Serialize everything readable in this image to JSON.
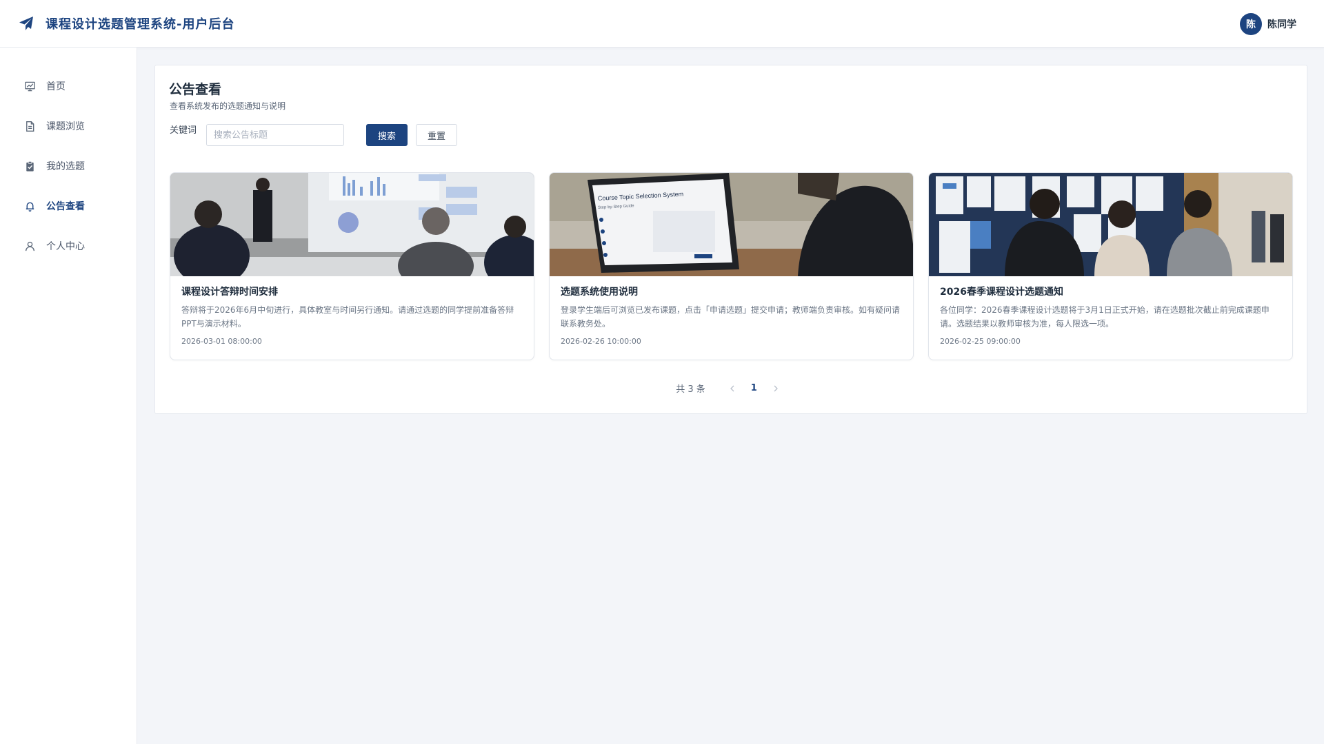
{
  "header": {
    "title": "课程设计选题管理系统-用户后台",
    "user": {
      "avatar_text": "陈",
      "name": "陈同学"
    }
  },
  "sidebar": {
    "items": [
      {
        "label": "首页",
        "icon": "chart-board-icon"
      },
      {
        "label": "课题浏览",
        "icon": "document-icon"
      },
      {
        "label": "我的选题",
        "icon": "clipboard-check-icon"
      },
      {
        "label": "公告查看",
        "icon": "bell-icon",
        "active": true
      },
      {
        "label": "个人中心",
        "icon": "user-icon"
      }
    ]
  },
  "main": {
    "title": "公告查看",
    "subtitle": "查看系统发布的选题通知与说明",
    "search": {
      "label": "关键词",
      "placeholder": "搜索公告标题",
      "value": "",
      "search_button": "搜索",
      "reset_button": "重置"
    },
    "notices": [
      {
        "title": "课程设计答辩时间安排",
        "summary": "答辩将于2026年6月中旬进行，具体教室与时间另行通知。请通过选题的同学提前准备答辩PPT与演示材料。",
        "date": "2026-03-01 08:00:00",
        "image": "presentation-meeting-photo"
      },
      {
        "title": "选题系统使用说明",
        "summary": "登录学生端后可浏览已发布课题，点击「申请选题」提交申请；教师端负责审核。如有疑问请联系教务处。",
        "date": "2026-02-26 10:00:00",
        "image": "laptop-system-photo",
        "image_text": {
          "title": "Course Topic Selection System",
          "subtitle": "Step-by-Step Guide"
        }
      },
      {
        "title": "2026春季课程设计选题通知",
        "summary": "各位同学：2026春季课程设计选题将于3月1日正式开始，请在选题批次截止前完成课题申请。选题结果以教师审核为准，每人限选一项。",
        "date": "2026-02-25 09:00:00",
        "image": "students-notice-board-photo"
      }
    ],
    "pagination": {
      "total_text": "共 3 条",
      "current_page": "1"
    }
  },
  "colors": {
    "primary": "#1d4480",
    "background": "#f3f5f9",
    "text_muted": "#6b7685"
  }
}
